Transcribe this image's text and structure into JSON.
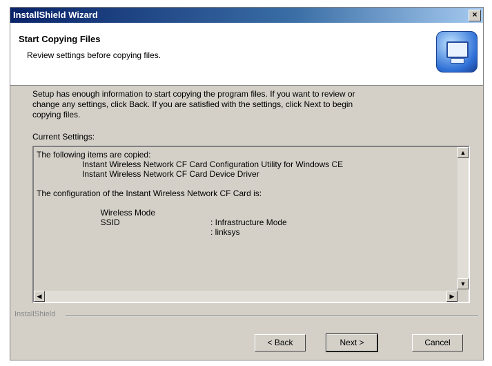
{
  "window": {
    "title": "InstallShield Wizard",
    "close_label": "×"
  },
  "header": {
    "title": "Start Copying Files",
    "subtitle": "Review settings before copying files."
  },
  "body_lines": [
    "Setup has enough information to start copying the program files.  If you want to review or",
    "change any settings, click Back.  If you are satisfied with the settings, click Next to begin",
    "copying files."
  ],
  "current_settings_label": "Current Settings:",
  "settings": {
    "intro": "The following items are copied:",
    "items": [
      "Instant Wireless Network CF Card Configuration Utility for Windows CE",
      "Instant Wireless Network CF Card Device Driver"
    ],
    "config_intro": "The configuration of the Instant Wireless Network CF Card is:",
    "config": [
      {
        "key": "Wireless Mode",
        "value": ": Infrastructure Mode"
      },
      {
        "key": "SSID",
        "value": ": linksys"
      }
    ]
  },
  "brand": "InstallShield",
  "buttons": {
    "back": "< Back",
    "next": "Next >",
    "cancel": "Cancel"
  },
  "colors": {
    "title_bar": "#0a246a",
    "dialog_bg": "#d4d0c8"
  }
}
